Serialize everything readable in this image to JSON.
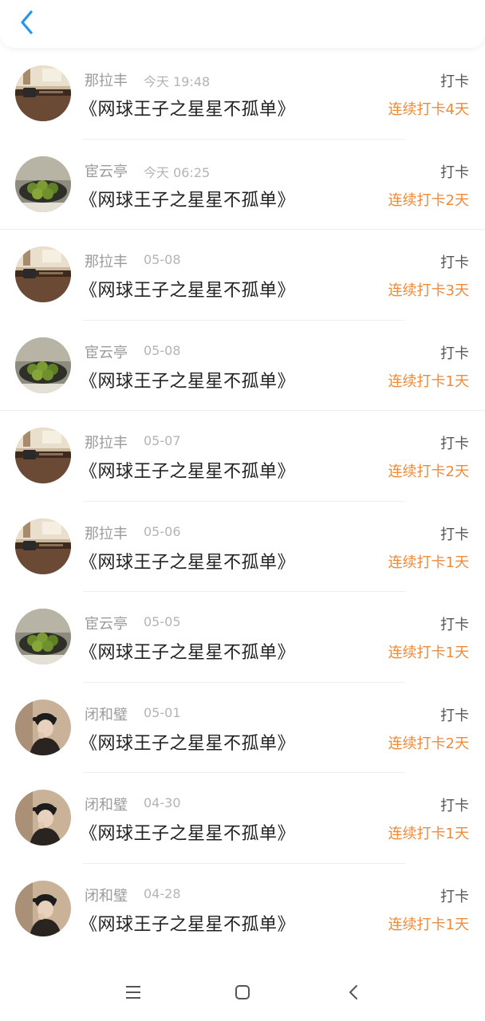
{
  "header": {
    "back_icon": "chevron-left-icon",
    "accent": "#2196f3"
  },
  "colors": {
    "streak": "#ee8a3c",
    "username": "#9b9b9b",
    "title": "#222222"
  },
  "records": [
    {
      "user": "那拉丰",
      "time": "今天 19:48",
      "book": "《网球王子之星星不孤单》",
      "type": "打卡",
      "streak": "连续打卡4天",
      "avatar": "desk"
    },
    {
      "user": "宦云亭",
      "time": "今天 06:25",
      "book": "《网球王子之星星不孤单》",
      "type": "打卡",
      "streak": "连续打卡2天",
      "avatar": "fruit"
    },
    {
      "user": "那拉丰",
      "time": "05-08",
      "book": "《网球王子之星星不孤单》",
      "type": "打卡",
      "streak": "连续打卡3天",
      "avatar": "desk"
    },
    {
      "user": "宦云亭",
      "time": "05-08",
      "book": "《网球王子之星星不孤单》",
      "type": "打卡",
      "streak": "连续打卡1天",
      "avatar": "fruit"
    },
    {
      "user": "那拉丰",
      "time": "05-07",
      "book": "《网球王子之星星不孤单》",
      "type": "打卡",
      "streak": "连续打卡2天",
      "avatar": "desk"
    },
    {
      "user": "那拉丰",
      "time": "05-06",
      "book": "《网球王子之星星不孤单》",
      "type": "打卡",
      "streak": "连续打卡1天",
      "avatar": "desk"
    },
    {
      "user": "宦云亭",
      "time": "05-05",
      "book": "《网球王子之星星不孤单》",
      "type": "打卡",
      "streak": "连续打卡1天",
      "avatar": "fruit"
    },
    {
      "user": "闭和璧",
      "time": "05-01",
      "book": "《网球王子之星星不孤单》",
      "type": "打卡",
      "streak": "连续打卡2天",
      "avatar": "person"
    },
    {
      "user": "闭和璧",
      "time": "04-30",
      "book": "《网球王子之星星不孤单》",
      "type": "打卡",
      "streak": "连续打卡1天",
      "avatar": "person"
    },
    {
      "user": "闭和璧",
      "time": "04-28",
      "book": "《网球王子之星星不孤单》",
      "type": "打卡",
      "streak": "连续打卡1天",
      "avatar": "person"
    }
  ],
  "nav": {
    "menu_icon": "menu-icon",
    "home_icon": "home-square-icon",
    "back_icon": "back-triangle-icon"
  }
}
